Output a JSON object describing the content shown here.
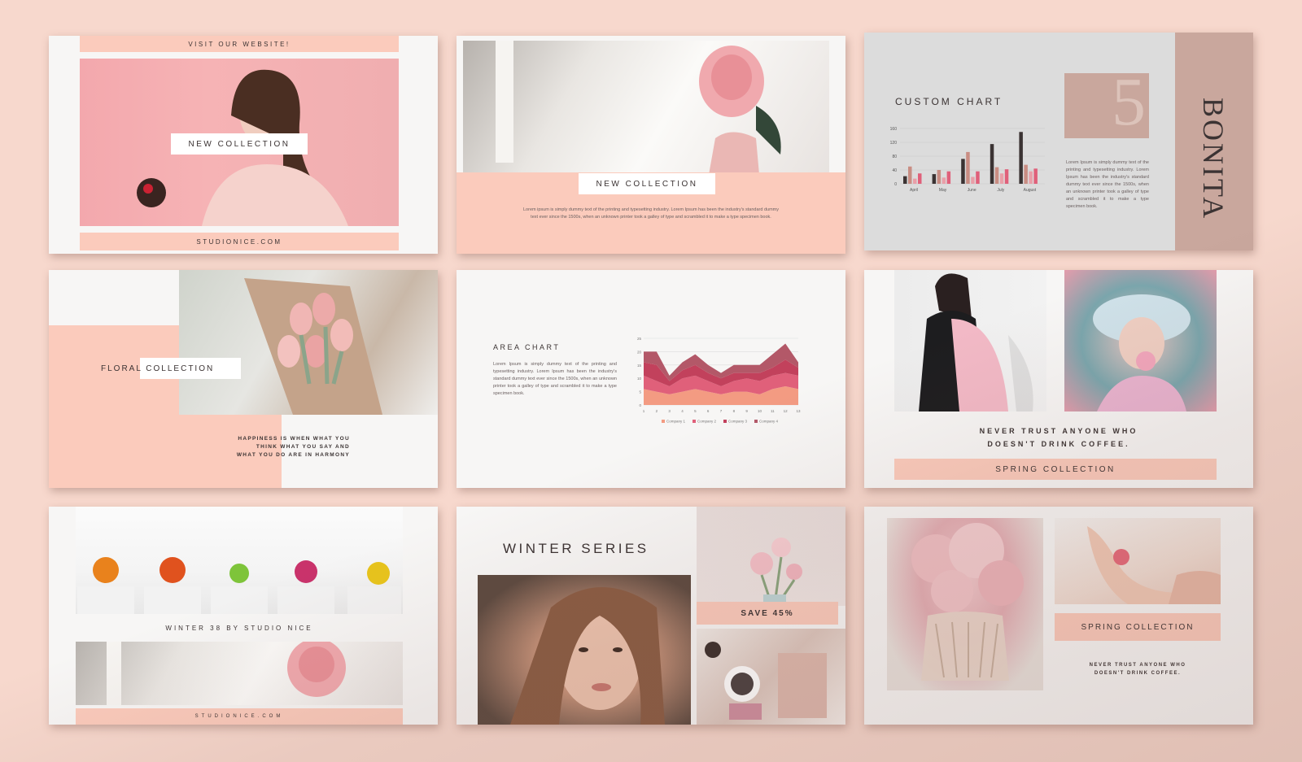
{
  "slide1": {
    "top_bar": "VISIT OUR WEBSITE!",
    "label": "NEW COLLECTION",
    "bottom_bar": "STUDIONICE.COM"
  },
  "slide2": {
    "label": "NEW COLLECTION",
    "text": "Lorem ipsum is simply dummy text of the printing and typesetting industry. Lorem Ipsum has been the industry's standard dummy text ever since the 1500s, when an unknown printer took a galley of type and scrambled it to make a type specimen book."
  },
  "slide3": {
    "title": "CUSTOM CHART",
    "number": "5",
    "brand": "BONITA",
    "text": "Lorem Ipsum is simply dummy text of the printing and typesetting industry. Lorem Ipsum has been the industry's standard dummy text ever since the 1500s, when an unknown printer took a galley of type and scrambled it to make a type specimen book."
  },
  "slide4": {
    "label": "FLORAL COLLECTION",
    "quote": [
      "HAPPINESS IS WHEN WHAT YOU",
      "THINK WHAT  YOU SAY AND",
      "WHAT YOU DO  ARE IN HARMONY"
    ]
  },
  "slide5": {
    "title": "AREA CHART",
    "text": "Lorem Ipsum is simply dummy text of the printing and typesetting industry. Lorem Ipsum has been the industry's standard dummy text ever since the 1500s, when an unknown printer took a galley of type and scrambled it to make a type specimen book."
  },
  "slide6": {
    "quote": [
      "NEVER TRUST ANYONE WHO",
      "DOESN'T DRINK COFFEE."
    ],
    "bar": "SPRING COLLECTION"
  },
  "slide7": {
    "caption": "WINTER 38 BY STUDIO NICE",
    "bottom_bar": "STUDIONICE.COM"
  },
  "slide8": {
    "title": "WINTER SERIES",
    "badge": "SAVE 45%"
  },
  "slide9": {
    "label": "SPRING COLLECTION",
    "quote": [
      "NEVER TRUST ANYONE WHO",
      "DOESN'T DRINK COFFEE."
    ]
  },
  "colors": {
    "peach": "#fbcbbc",
    "mauve": "#c9a79d",
    "dark": "#3b3333",
    "pink": "#e0607a",
    "rose": "#b35868",
    "salmon": "#f39b82"
  },
  "chart_data": [
    {
      "type": "bar",
      "categories": [
        "April",
        "May",
        "June",
        "July",
        "August"
      ],
      "ylim": [
        0,
        160
      ],
      "yticks": [
        0,
        40,
        80,
        120,
        160
      ],
      "series": [
        {
          "values": [
            22,
            28,
            72,
            115,
            150
          ]
        },
        {
          "values": [
            50,
            40,
            92,
            48,
            55
          ]
        },
        {
          "values": [
            15,
            18,
            20,
            30,
            36
          ]
        },
        {
          "values": [
            30,
            36,
            36,
            42,
            44
          ]
        }
      ]
    },
    {
      "type": "area",
      "x": [
        1,
        2,
        3,
        4,
        5,
        6,
        7,
        8,
        9,
        10,
        11,
        12,
        13
      ],
      "ylim": [
        0,
        25
      ],
      "yticks": [
        0,
        5,
        10,
        15,
        20,
        25
      ],
      "series": [
        {
          "name": "Company 1",
          "values": [
            6,
            5,
            4,
            5,
            6,
            5,
            4,
            5,
            5,
            4,
            6,
            7,
            6
          ]
        },
        {
          "name": "Company 2",
          "values": [
            5,
            4,
            3,
            5,
            5,
            4,
            3,
            4,
            5,
            5,
            5,
            5,
            5
          ]
        },
        {
          "name": "Company 3",
          "values": [
            5,
            6,
            2,
            3,
            4,
            3,
            3,
            3,
            2,
            3,
            3,
            5,
            3
          ]
        },
        {
          "name": "Company 4",
          "values": [
            4,
            5,
            2,
            3,
            4,
            3,
            2,
            3,
            3,
            3,
            5,
            6,
            2
          ]
        }
      ]
    }
  ]
}
